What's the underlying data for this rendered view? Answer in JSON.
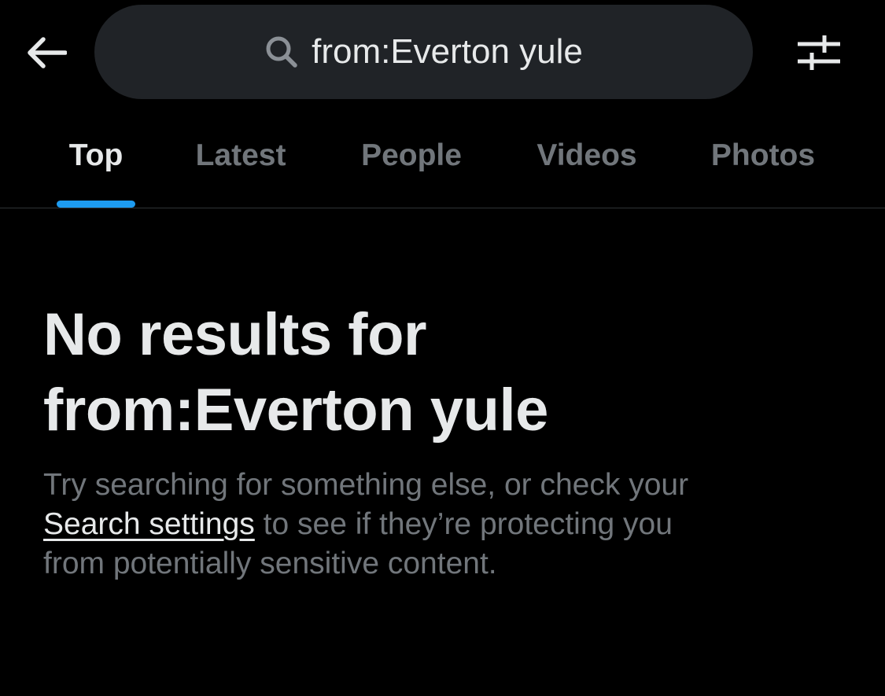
{
  "search": {
    "query": "from:Everton yule",
    "back_icon": "arrow-left-icon",
    "search_icon": "magnifier-icon",
    "filter_icon": "sliders-icon"
  },
  "tabs": [
    {
      "label": "Top",
      "active": true
    },
    {
      "label": "Latest",
      "active": false
    },
    {
      "label": "People",
      "active": false
    },
    {
      "label": "Videos",
      "active": false
    },
    {
      "label": "Photos",
      "active": false
    }
  ],
  "empty_state": {
    "title_line1": "No results for",
    "title_line2": "from:Everton yule",
    "body_line1": "Try searching for something else, or check your",
    "link_text": "Search settings",
    "body_line2_rest": " to see if they’re protecting you",
    "body_line3": "from potentially sensitive content."
  },
  "colors": {
    "background": "#000000",
    "search_bg": "#202327",
    "primary_text": "#e7e9ea",
    "secondary_text": "#71767b",
    "accent": "#1d9bf0",
    "divider": "#2f3336"
  }
}
